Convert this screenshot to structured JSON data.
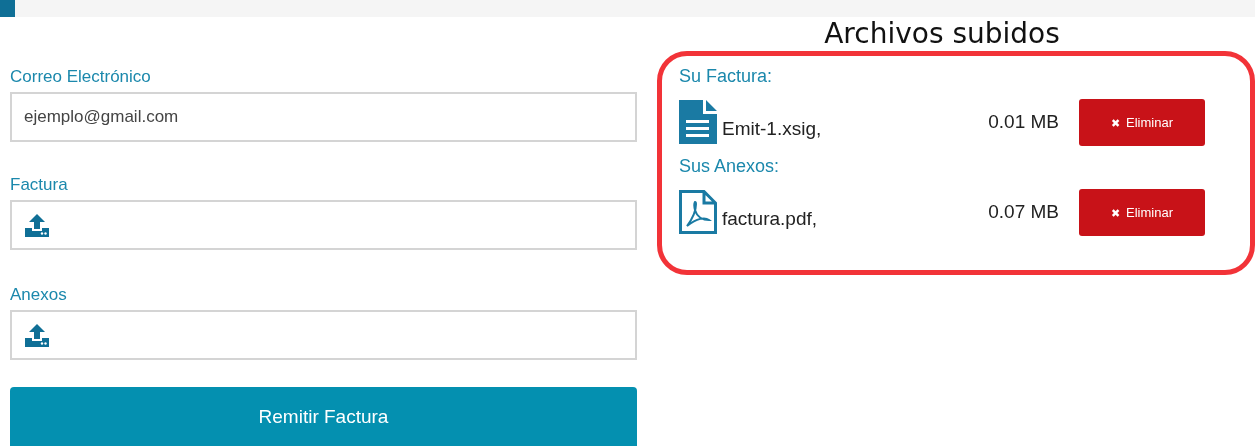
{
  "form": {
    "fields": [
      {
        "kind": "text",
        "label": "Correo Electrónico",
        "value": "ejemplo@gmail.com"
      },
      {
        "kind": "upload",
        "label": "Factura"
      },
      {
        "kind": "upload",
        "label": "Anexos"
      }
    ],
    "submit": "Remitir Factura"
  },
  "uploads": {
    "title": "Archivos subidos",
    "sections": [
      {
        "label": "Su Factura:",
        "files": [
          {
            "kind": "document",
            "name": "Emit-1.xsig,",
            "size": "0.01 MB",
            "icon": "✖",
            "action": "Eliminar"
          }
        ]
      },
      {
        "label": "Sus Anexos:",
        "files": [
          {
            "kind": "pdf",
            "name": "factura.pdf,",
            "size": "0.07 MB",
            "icon": "✖",
            "action": "Eliminar"
          }
        ]
      }
    ]
  }
}
